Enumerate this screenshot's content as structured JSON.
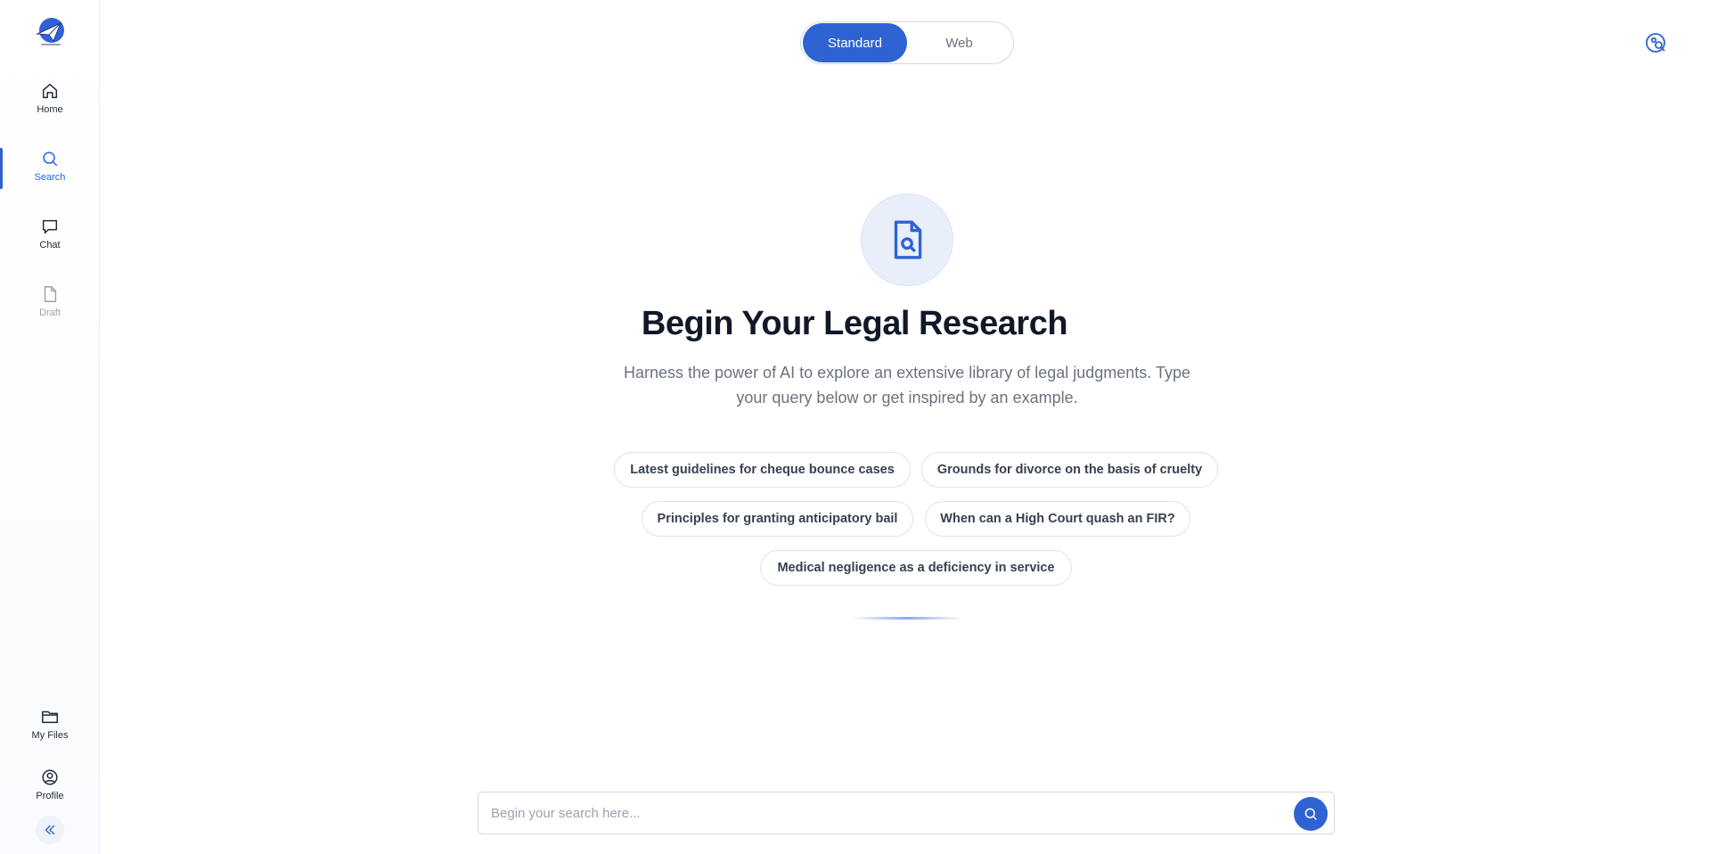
{
  "sidebar": {
    "logo_icon": "paper-plane-logo",
    "items": [
      {
        "label": "Home",
        "icon": "home-icon"
      },
      {
        "label": "Search",
        "icon": "search-icon"
      },
      {
        "label": "Chat",
        "icon": "chat-icon"
      },
      {
        "label": "Draft",
        "icon": "document-icon"
      }
    ],
    "bottom_items": [
      {
        "label": "My Files",
        "icon": "folder-icon"
      },
      {
        "label": "Profile",
        "icon": "user-circle-icon"
      }
    ],
    "collapse_icon": "double-chevron-left-icon"
  },
  "mode_toggle": {
    "options": [
      "Standard",
      "Web"
    ],
    "selected": "Standard"
  },
  "hero": {
    "title": "Begin Your Legal Research",
    "subtitle": "Harness the power of AI to explore an extensive library of legal judgments. Type your query below or get inspired by an example."
  },
  "suggestions": [
    "Latest guidelines for cheque bounce cases",
    "Grounds for divorce on the basis of cruelty",
    "Principles for granting anticipatory bail",
    "When can a High Court quash an FIR?",
    "Medical negligence as a deficiency in service"
  ],
  "search": {
    "placeholder": "Begin your search here..."
  },
  "colors": {
    "accent": "#2f63d4",
    "hero_circle_bg": "#e9eefb"
  }
}
